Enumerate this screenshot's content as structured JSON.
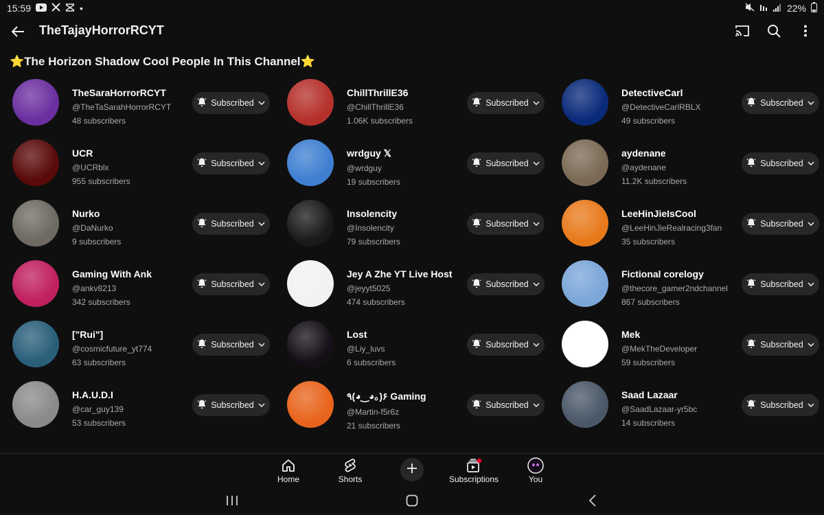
{
  "status_bar": {
    "time": "15:59",
    "notif_icons": [
      "youtube-icon",
      "x-icon",
      "capcut-icon"
    ],
    "dot": "•",
    "battery": "22%"
  },
  "app_bar": {
    "title": "TheTajayHorrorRCYT"
  },
  "section": {
    "title": "⭐The Horizon Shadow Cool People In This Channel⭐"
  },
  "channels": [
    {
      "name": "TheSaraHorrorRCYT",
      "handle": "@TheTaSarahHorrorRCYT",
      "subs": "48 subscribers",
      "button": "Subscribed",
      "avatar_color": "#6b2fa0"
    },
    {
      "name": "ChillThrillE36",
      "handle": "@ChillThrillE36",
      "subs": "1.06K subscribers",
      "button": "Subscribed",
      "avatar_color": "#b5312b"
    },
    {
      "name": "DetectiveCarl",
      "handle": "@DetectiveCarlRBLX",
      "subs": "49 subscribers",
      "button": "Subscribed",
      "avatar_color": "#0a2a7a"
    },
    {
      "name": "UCR",
      "handle": "@UCRblx",
      "subs": "955 subscribers",
      "button": "Subscribed",
      "avatar_color": "#5a0a0a"
    },
    {
      "name": "wrdguy 𝕏",
      "handle": "@wrdguy",
      "subs": "19 subscribers",
      "button": "Subscribed",
      "avatar_color": "#3f7fd1"
    },
    {
      "name": "aydenane",
      "handle": "@aydenane",
      "subs": "11.2K subscribers",
      "button": "Subscribed",
      "avatar_color": "#7a6a55"
    },
    {
      "name": "Nurko",
      "handle": "@DaNurko",
      "subs": "9 subscribers",
      "button": "Subscribed",
      "avatar_color": "#6e6a62"
    },
    {
      "name": "Insolencity",
      "handle": "@Insolencity",
      "subs": "79 subscribers",
      "button": "Subscribed",
      "avatar_color": "#1a1a1a"
    },
    {
      "name": "LeeHinJieIsCool",
      "handle": "@LeeHinJieRealracing3fan",
      "subs": "35 subscribers",
      "button": "Subscribed",
      "avatar_color": "#e87a1c"
    },
    {
      "name": "Gaming With Ank",
      "handle": "@ankv8213",
      "subs": "342 subscribers",
      "button": "Subscribed",
      "avatar_color": "#c02060"
    },
    {
      "name": "Jey A Zhe YT Live Host",
      "handle": "@jeyyt5025",
      "subs": "474 subscribers",
      "button": "Subscribed",
      "avatar_color": "#f2f2f2"
    },
    {
      "name": "Fictional corelogy",
      "handle": "@thecore_gamer2ndchannel",
      "subs": "867 subscribers",
      "button": "Subscribed",
      "avatar_color": "#7aa6d8"
    },
    {
      "name": "[\"Rui\"]",
      "handle": "@cosmicfuture_yt774",
      "subs": "63 subscribers",
      "button": "Subscribed",
      "avatar_color": "#2a5f7a"
    },
    {
      "name": "Lost",
      "handle": "@Liy_luvs",
      "subs": "6 subscribers",
      "button": "Subscribed",
      "avatar_color": "#151018"
    },
    {
      "name": "Mek",
      "handle": "@MekTheDeveloper",
      "subs": "59 subscribers",
      "button": "Subscribed",
      "avatar_color": "#ffffff"
    },
    {
      "name": "H.A.U.D.I",
      "handle": "@car_guy139",
      "subs": "53 subscribers",
      "button": "Subscribed",
      "avatar_color": "#8a8a8a"
    },
    {
      "name": "٩(◕‿◕｡)۶ Gaming",
      "handle": "@Martin-f5r6z",
      "subs": "21 subscribers",
      "button": "Subscribed",
      "avatar_color": "#e8641c"
    },
    {
      "name": "Saad Lazaar",
      "handle": "@SaadLazaar-yr5bc",
      "subs": "14 subscribers",
      "button": "Subscribed",
      "avatar_color": "#4a5868"
    }
  ],
  "bottom_nav": {
    "home": "Home",
    "shorts": "Shorts",
    "subscriptions": "Subscriptions",
    "you": "You"
  },
  "colors": {
    "background": "#0f0f0f",
    "button_bg": "#272727",
    "secondary_text": "#aaaaaa",
    "notification_dot": "#ff0033"
  }
}
